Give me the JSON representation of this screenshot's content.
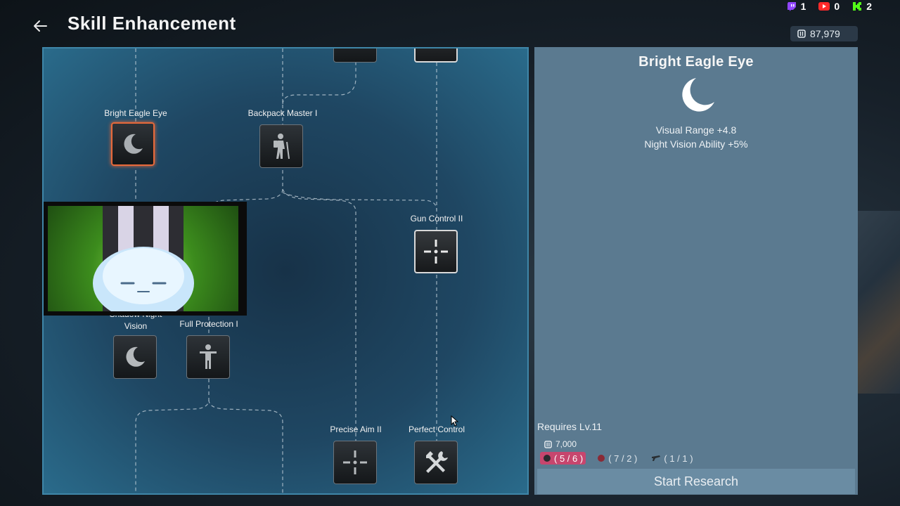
{
  "header": {
    "title": "Skill Enhancement"
  },
  "counters": [
    {
      "icon": "twitch-icon",
      "value": "1",
      "color": "#9146ff"
    },
    {
      "icon": "youtube-icon",
      "value": "0",
      "color": "#ff2a2a"
    },
    {
      "icon": "kick-icon",
      "value": "2",
      "color": "#53fc18"
    }
  ],
  "currency": {
    "icon": "coin-icon",
    "amount": "87,979"
  },
  "tree": {
    "nodes": [
      {
        "label": "Bright Eagle Eye",
        "icon": "moon-icon",
        "state": "selected"
      },
      {
        "label": "Backpack Master I",
        "icon": "hiker-icon",
        "state": "normal"
      },
      {
        "label": "Gun Control II",
        "icon": "crosshair-icon",
        "state": "highlight"
      },
      {
        "label": "Shadow Night Vision",
        "icon": "moon-icon",
        "state": "normal"
      },
      {
        "label": "Full Protection I",
        "icon": "person-icon",
        "state": "normal"
      },
      {
        "label": "Precise Aim II",
        "icon": "crosshair-icon",
        "state": "normal"
      },
      {
        "label": "Perfect Control",
        "icon": "tools-icon",
        "state": "normal"
      }
    ]
  },
  "detail": {
    "title": "Bright Eagle Eye",
    "icon": "moon-icon",
    "stats": [
      "Visual Range +4.8",
      "Night Vision Ability +5%"
    ],
    "requires": "Requires Lv.11",
    "cost": "7,000",
    "materials": [
      {
        "icon": "dark-material-icon",
        "text": "( 5 / 6 )",
        "lacking": true
      },
      {
        "icon": "red-material-icon",
        "text": "( 7 / 2 )",
        "lacking": false
      },
      {
        "icon": "gun-part-icon",
        "text": "( 1 / 1 )",
        "lacking": false
      }
    ],
    "button": "Start Research"
  }
}
